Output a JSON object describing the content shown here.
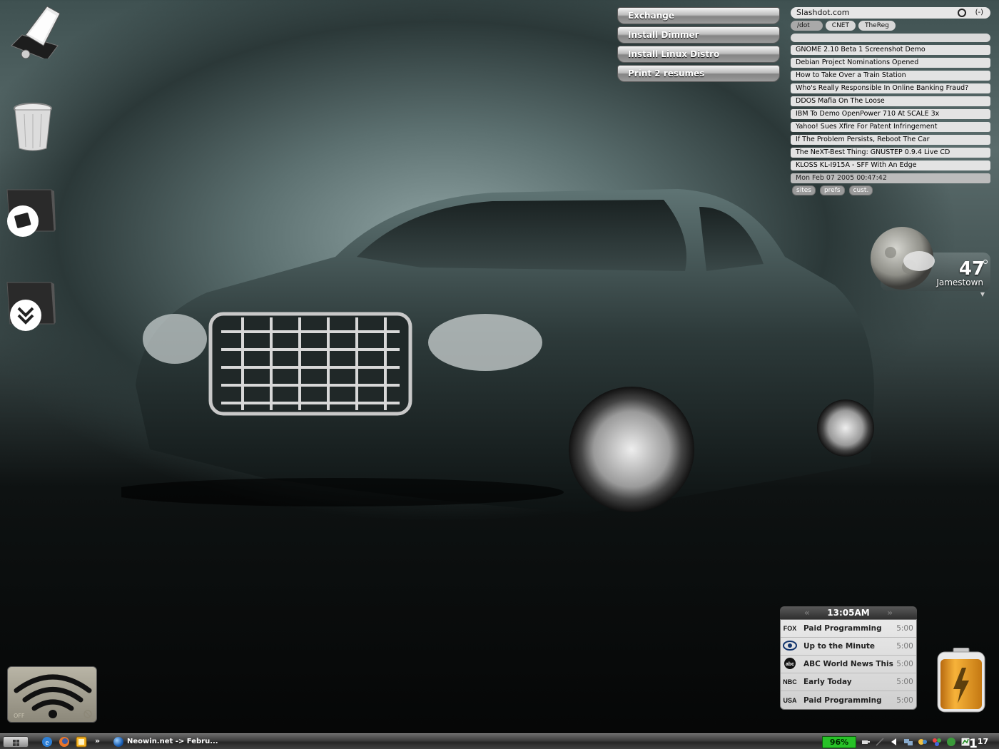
{
  "launcher": {
    "buttons": [
      "Exchange",
      "Install Dimmer",
      "Install Linux Distro",
      "Print 2 resumes"
    ]
  },
  "news": {
    "title": "Slashdot.com",
    "control": "(-)",
    "tabs": [
      "/dot",
      "CNET",
      "TheReg"
    ],
    "headlines": [
      "GNOME 2.10 Beta 1 Screenshot Demo",
      "Debian Project Nominations Opened",
      "How to Take Over a Train Station",
      "Who's Really Responsible In Online Banking Fraud?",
      "DDOS Mafia On The Loose",
      "IBM To Demo OpenPower 710 At SCALE 3x",
      "Yahoo! Sues Xfire For Patent Infringement",
      "If The Problem Persists, Reboot The Car",
      "The NeXT-Best Thing: GNUSTEP 0.9.4 Live CD",
      "KLOSS KL-I915A - SFF With An Edge"
    ],
    "timestamp": "Mon Feb 07 2005 00:47:42",
    "footer": [
      "sites",
      "prefs",
      "cust."
    ]
  },
  "weather": {
    "temperature": "47",
    "city": "Jamestown"
  },
  "tvguide": {
    "time": "13:05AM",
    "listings": [
      {
        "channel": "FOX",
        "title": "Paid Programming",
        "time": "5:00"
      },
      {
        "channel": "CBS",
        "title": "Up to the Minute",
        "time": "5:00"
      },
      {
        "channel": "abc",
        "title": "ABC World News This...",
        "time": "5:00"
      },
      {
        "channel": "NBC",
        "title": "Early Today",
        "time": "5:00"
      },
      {
        "channel": "USA",
        "title": "Paid Programming",
        "time": "5:00"
      }
    ]
  },
  "wifi": {
    "state_label": "OFF"
  },
  "taskbar": {
    "overflow": "»",
    "task_label": "Neowin.net -> Febru...",
    "battery_percent": "96%",
    "clock_hour": "1",
    "clock_minute": "17"
  },
  "colors": {
    "battery_meter": "#27c227",
    "battery_widget": "#f0a020"
  }
}
